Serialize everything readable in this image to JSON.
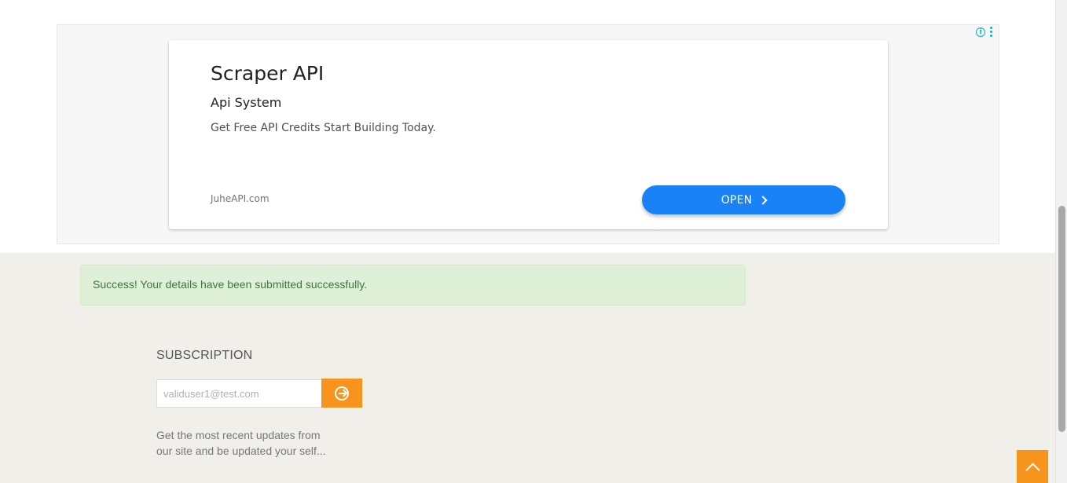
{
  "ad": {
    "title": "Scraper API",
    "subtitle": "Api System",
    "description": "Get Free API Credits Start Building Today.",
    "domain": "JuheAPI.com",
    "open_label": "OPEN",
    "info_icon": "info-icon",
    "menu_icon": "more-vertical-icon"
  },
  "alert": {
    "message": "Success! Your details have been submitted successfully."
  },
  "subscription": {
    "title": "SUBSCRIPTION",
    "email_placeholder": "validuser1@test.com",
    "submit_icon": "arrow-circle-right-icon",
    "description": "Get the most recent updates from our site and be updated your self..."
  },
  "back_to_top": {
    "icon": "chevron-up-icon"
  },
  "colors": {
    "accent": "#f7941d",
    "ad_button": "#1a82f7",
    "alert_bg": "#dff0d8",
    "alert_text": "#3c763d",
    "page_bg": "#f0efe9"
  }
}
